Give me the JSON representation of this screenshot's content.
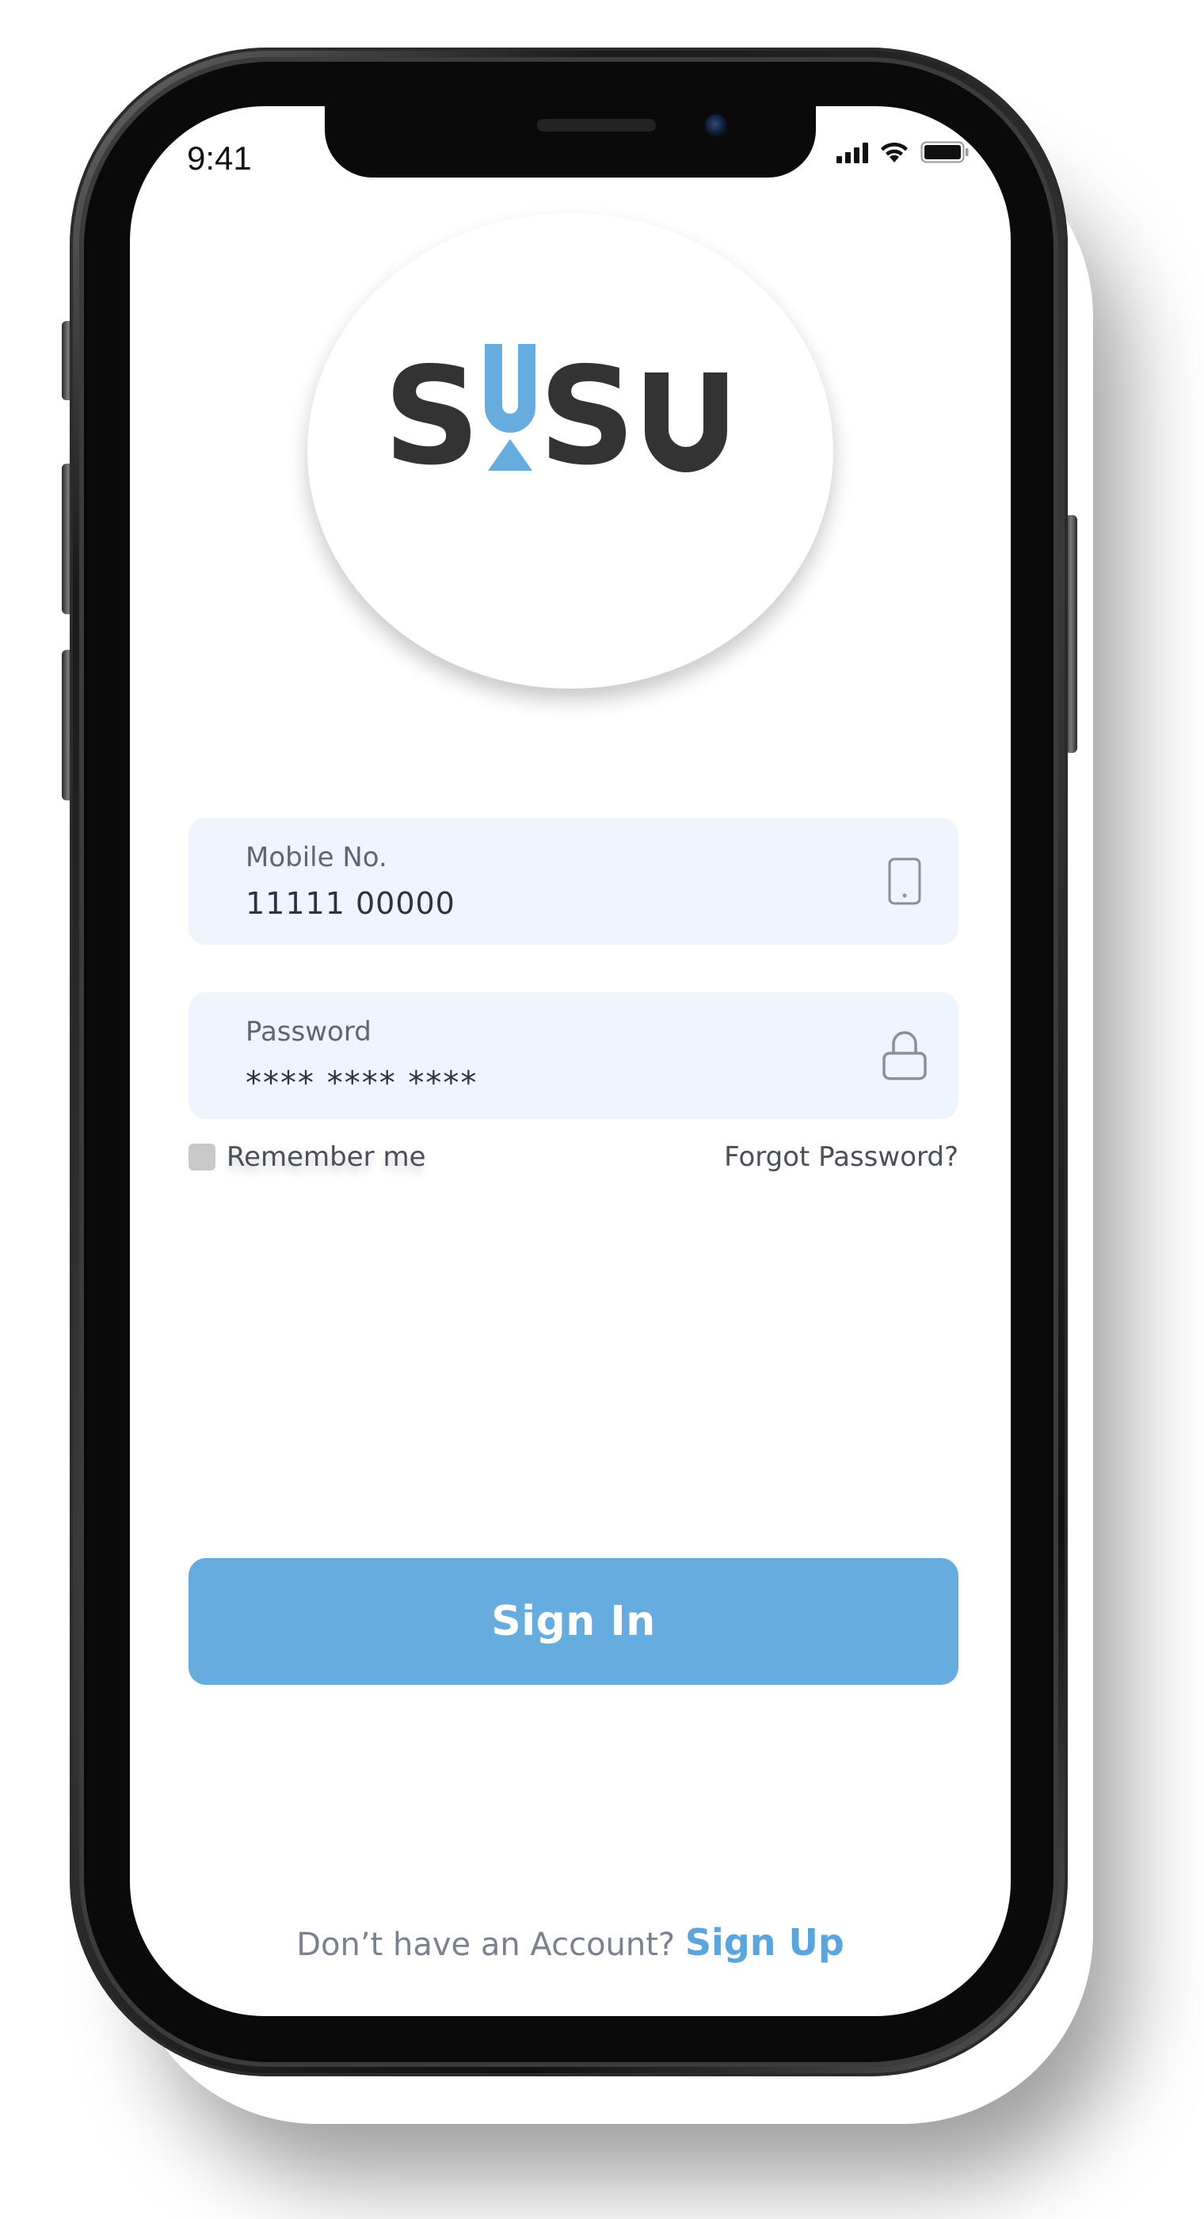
{
  "status_bar": {
    "time": "9:41",
    "icons": [
      "cellular-signal-icon",
      "wifi-icon",
      "battery-icon"
    ]
  },
  "logo": {
    "text": "SUSU",
    "dark_color": "#333333",
    "accent_color": "#67acdf"
  },
  "form": {
    "mobile": {
      "label": "Mobile No.",
      "value": "11111 00000",
      "icon": "phone-icon"
    },
    "password": {
      "label": "Password",
      "value": "**** **** ****",
      "icon": "lock-icon"
    },
    "remember_label": "Remember me",
    "remember_checked": false,
    "forgot_label": "Forgot Password?"
  },
  "signin": {
    "label": "Sign In",
    "color": "#67acdf"
  },
  "signup": {
    "prompt": "Don’t have an Account?",
    "link": "Sign Up",
    "link_color": "#5aa5dd"
  },
  "colors": {
    "field_background": "#eef5fc",
    "text_muted": "#5f6672"
  }
}
